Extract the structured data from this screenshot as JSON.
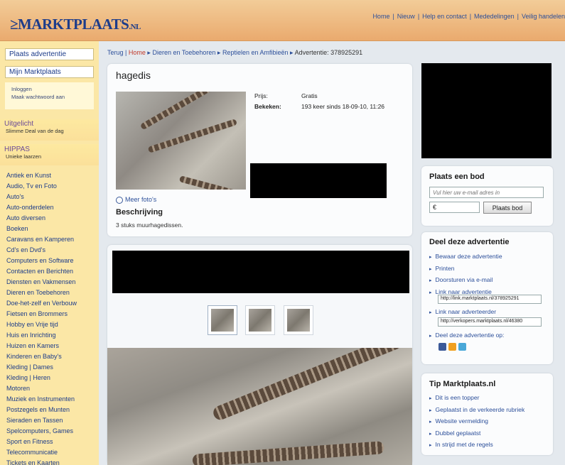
{
  "header": {
    "logo_text": "≥MARKTPLAATS",
    "logo_tld": ".NL",
    "nav": [
      "Home",
      "Nieuw",
      "Help en contact",
      "Mededelingen",
      "Veilig handelen"
    ],
    "nav_sep": "|"
  },
  "sidebar": {
    "plaats_button": "Plaats advertentie",
    "mijn_button": "Mijn Marktplaats",
    "login": "Inloggen",
    "wachtwoord": "Maak wachtwoord aan",
    "uitgelicht_title": "Uitgelicht",
    "uitgelicht_sub": "Slimme Deal van de dag",
    "hippas_title": "HIPPAS",
    "hippas_sub": "Unieke laarzen",
    "categories": [
      "Antiek en Kunst",
      "Audio, Tv en Foto",
      "Auto's",
      "Auto-onderdelen",
      "Auto diversen",
      "Boeken",
      "Caravans en Kamperen",
      "Cd's en Dvd's",
      "Computers en Software",
      "Contacten en Berichten",
      "Diensten en Vakmensen",
      "Dieren en Toebehoren",
      "Doe-het-zelf en Verbouw",
      "Fietsen en Brommers",
      "Hobby en Vrije tijd",
      "Huis en Inrichting",
      "Huizen en Kamers",
      "Kinderen en Baby's",
      "Kleding | Dames",
      "Kleding | Heren",
      "Motoren",
      "Muziek en Instrumenten",
      "Postzegels en Munten",
      "Sieraden en Tassen",
      "Spelcomputers, Games",
      "Sport en Fitness",
      "Telecommunicatie",
      "Tickets en Kaarten"
    ]
  },
  "breadcrumb": {
    "terug": "Terug",
    "sep": "|",
    "home": "Home",
    "arrow": "▸",
    "c1": "Dieren en Toebehoren",
    "c2": "Reptielen en Amfibieën",
    "c3": "Advertentie: 378925291"
  },
  "ad": {
    "title": "hagedis",
    "prijs_label": "Prijs:",
    "prijs_value": "Gratis",
    "bekeken_label": "Bekeken:",
    "bekeken_value": "193 keer sinds 18-09-10, 11:26",
    "meer_fotos": "Meer foto's",
    "beschrijving_title": "Beschrijving",
    "beschrijving_text": "3 stuks muurhagedissen."
  },
  "bod": {
    "title": "Plaats een bod",
    "email_placeholder": "Vul hier uw e-mail adres in",
    "euro_value": "€",
    "button": "Plaats bod"
  },
  "deel": {
    "title": "Deel deze advertentie",
    "links": [
      "Bewaar deze advertentie",
      "Printen",
      "Doorsturen via e-mail",
      "Link naar advertentie"
    ],
    "link_url": "http://link.marktplaats.nl/378925291",
    "adverteerder": "Link naar adverteerder",
    "adverteerder_url": "http://verkopers.marktplaats.nl/46380",
    "deel_op": "Deel deze advertentie op:"
  },
  "tip": {
    "title": "Tip Marktplaats.nl",
    "links": [
      "Dit is een topper",
      "Geplaatst in de verkeerde rubriek",
      "Website vermelding",
      "Dubbel geplaatst",
      "In strijd met de regels"
    ]
  },
  "colors": {
    "header": "#eaaa6e",
    "sidebar": "#fbe7a6",
    "link": "#2c4f9a",
    "logo": "#1d3c8a"
  }
}
